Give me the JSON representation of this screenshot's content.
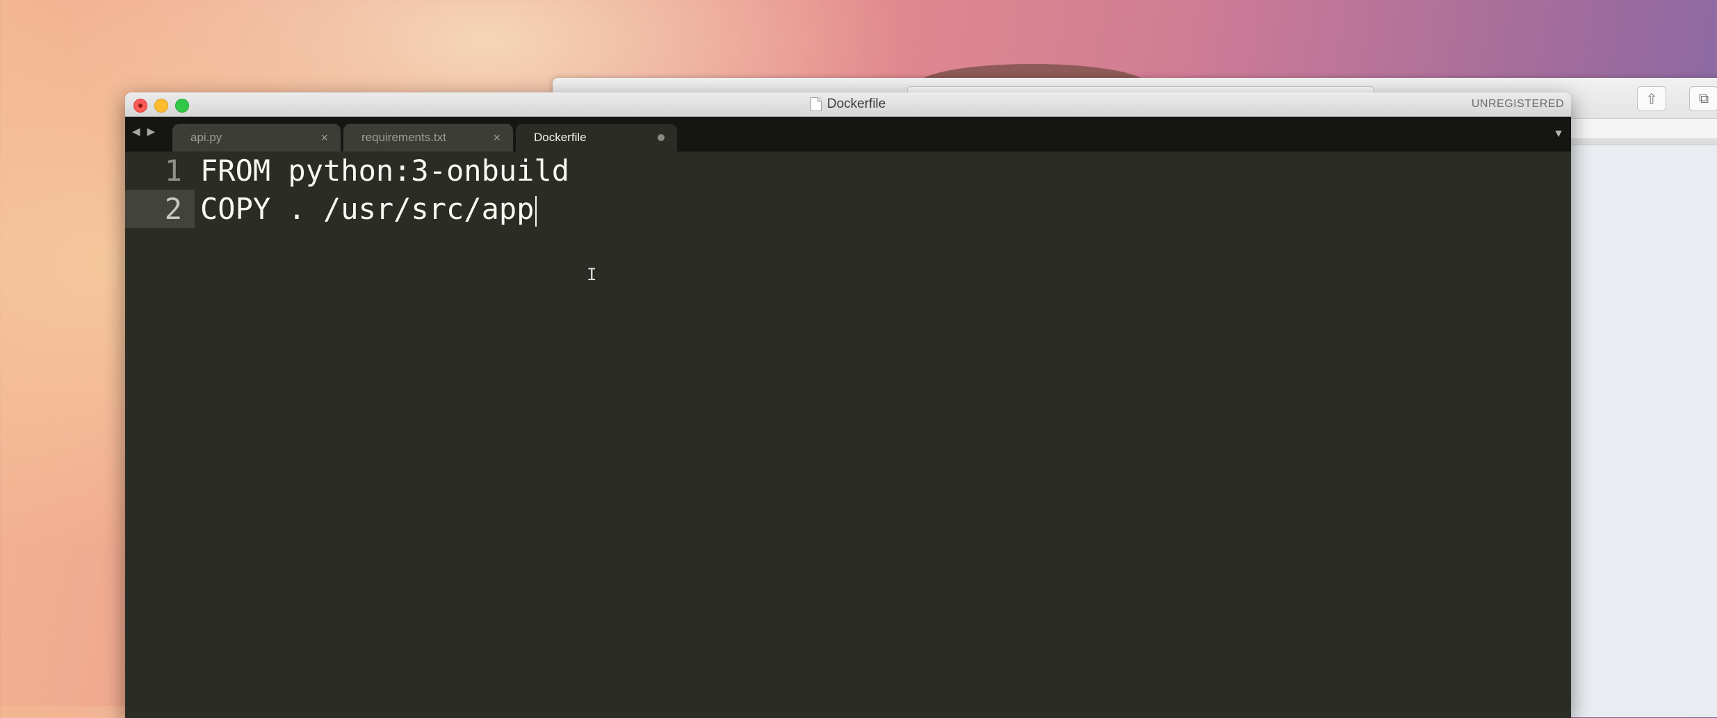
{
  "window": {
    "title": "Dockerfile",
    "registration": "UNREGISTERED"
  },
  "tabs": [
    {
      "label": "api.py",
      "close": "×"
    },
    {
      "label": "requirements.txt",
      "close": "×"
    },
    {
      "label": "Dockerfile",
      "state": "modified",
      "active": true
    }
  ],
  "nav": {
    "back": "◀",
    "forward": "▶",
    "tab_menu": "▼"
  },
  "editor": {
    "lines": [
      {
        "number": "1",
        "text": "FROM python:3-onbuild"
      },
      {
        "number": "2",
        "text": "COPY . /usr/src/app"
      }
    ],
    "current_line": 2
  },
  "colors": {
    "editor_background": "#2b2c25",
    "tab_bar": "#151612",
    "text": "#f8f8f2",
    "gutter_text": "#8f908a"
  },
  "icons": [
    "close-icon",
    "minimize-icon",
    "maximize-icon",
    "document-icon",
    "back-arrow-icon",
    "forward-arrow-icon",
    "tab-close-icon",
    "dirty-dot-icon",
    "tab-menu-icon",
    "text-cursor-icon",
    "share-icon",
    "tabs-overview-icon"
  ]
}
